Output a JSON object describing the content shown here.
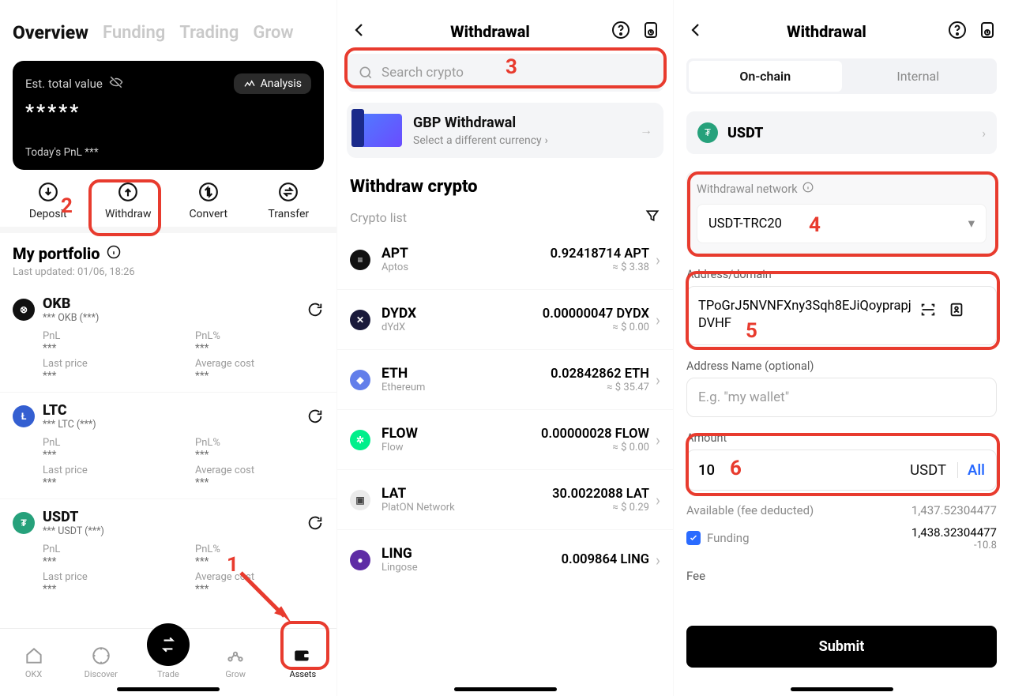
{
  "screen1": {
    "tabs": [
      "Overview",
      "Funding",
      "Trading",
      "Grow"
    ],
    "estLabel": "Est. total value",
    "analysis": "Analysis",
    "masked": "*****",
    "pnlLine": "Today's PnL ***",
    "actions": {
      "deposit": "Deposit",
      "withdraw": "Withdraw",
      "convert": "Convert",
      "transfer": "Transfer"
    },
    "portfolioTitle": "My portfolio",
    "lastUpdated": "Last updated: 01/06, 18:26",
    "fields": {
      "pnl": "PnL",
      "pnlPct": "PnL%",
      "lastPrice": "Last price",
      "avgCost": "Average cost",
      "triple": "***"
    },
    "assets": [
      {
        "sym": "OKB",
        "sub": "*** OKB (***)",
        "iconBg": "#111",
        "iconFg": "#fff",
        "iconTxt": "⊗"
      },
      {
        "sym": "LTC",
        "sub": "*** LTC  (***)",
        "iconBg": "#345fd1",
        "iconFg": "#fff",
        "iconTxt": "Ł"
      },
      {
        "sym": "USDT",
        "sub": "*** USDT (***)",
        "iconBg": "#26a17b",
        "iconFg": "#fff",
        "iconTxt": "₮"
      }
    ],
    "tabbar": {
      "okx": "OKX",
      "discover": "Discover",
      "trade": "Trade",
      "grow": "Grow",
      "assets": "Assets"
    }
  },
  "screen2": {
    "title": "Withdrawal",
    "searchPlaceholder": "Search crypto",
    "banner": {
      "title": "GBP Withdrawal",
      "subtitle": "Select a different currency"
    },
    "heading": "Withdraw crypto",
    "cryptoList": "Crypto list",
    "rows": [
      {
        "sym": "APT",
        "name": "Aptos",
        "amt": "0.92418714 APT",
        "usd": "≈ $ 3.38",
        "bg": "#111",
        "fg": "#fff",
        "t": "≡"
      },
      {
        "sym": "DYDX",
        "name": "dYdX",
        "amt": "0.00000047 DYDX",
        "usd": "≈ $ 0.00",
        "bg": "#1a1a3b",
        "fg": "#fff",
        "t": "✕"
      },
      {
        "sym": "ETH",
        "name": "Ethereum",
        "amt": "0.02842862 ETH",
        "usd": "≈ $ 35.47",
        "bg": "#627eea",
        "fg": "#fff",
        "t": "◆"
      },
      {
        "sym": "FLOW",
        "name": "Flow",
        "amt": "0.00000028 FLOW",
        "usd": "≈ $ 0.00",
        "bg": "#00ef8b",
        "fg": "#fff",
        "t": "✲"
      },
      {
        "sym": "LAT",
        "name": "PlatON Network",
        "amt": "30.0022088 LAT",
        "usd": "≈ $ 0.29",
        "bg": "#eaeaea",
        "fg": "#444",
        "t": "▣"
      },
      {
        "sym": "LING",
        "name": "Lingose",
        "amt": "0.009864 LING",
        "usd": "",
        "bg": "#5e2ca5",
        "fg": "#fff",
        "t": "●"
      }
    ]
  },
  "screen3": {
    "title": "Withdrawal",
    "segOnchain": "On-chain",
    "segInternal": "Internal",
    "token": "USDT",
    "withdrawalNetworkLabel": "Withdrawal network",
    "network": "USDT-TRC20",
    "addressLabel": "Address/domain",
    "address": "TPoGrJ5NVNFXny3Sqh8EJiQoyprapjDVHF",
    "addressNameLabel": "Address Name (optional)",
    "addressNamePlaceholder": "E.g. \"my wallet\"",
    "amountLabel": "Amount",
    "amountValue": "10",
    "amountUnit": "USDT",
    "amountAll": "All",
    "availableLabel": "Available (fee deducted)",
    "availableValue": "1,437.52304477",
    "fundingLabel": "Funding",
    "fundingValue": "1,438.32304477",
    "fundingFee": "-10.8",
    "feeLabel": "Fee",
    "submit": "Submit"
  },
  "annotations": {
    "n1": "1",
    "n2": "2",
    "n3": "3",
    "n4": "4",
    "n5": "5",
    "n6": "6"
  }
}
